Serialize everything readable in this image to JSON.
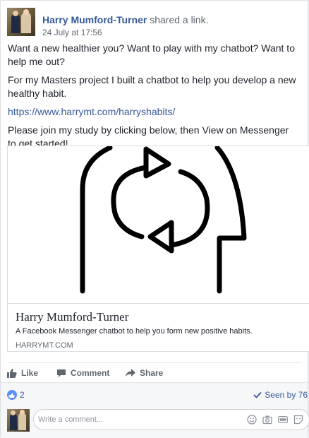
{
  "post": {
    "author": "Harry Mumford-Turner",
    "action": "shared a link.",
    "timestamp": "24 July at 17:56",
    "paragraph1": "Want a new healthier you? Want to play with my chatbot? Want to help me out?",
    "paragraph2": "For my Masters project I built a chatbot to help you develop a new healthy habit.",
    "link": "https://www.harrymt.com/harryshabits/",
    "paragraph3": "Please join my study by clicking below, then View on Messenger to get started!"
  },
  "card": {
    "title": "Harry Mumford-Turner",
    "description": "A Facebook Messenger chatbot to help you form new positive habits.",
    "domain": "HARRYMT.COM"
  },
  "actions": {
    "like": "Like",
    "comment": "Comment",
    "share": "Share"
  },
  "stats": {
    "likes": "2",
    "seen": "Seen by 76"
  },
  "comment_box": {
    "placeholder": "Write a comment..."
  },
  "colors": {
    "link": "#365899",
    "like_blue": "#598eff",
    "muted": "#606770"
  },
  "icons": [
    "thumbs-up-icon",
    "comment-icon",
    "share-arrow-icon",
    "check-icon",
    "emoji-icon",
    "camera-icon",
    "gif-icon",
    "sticker-icon"
  ]
}
